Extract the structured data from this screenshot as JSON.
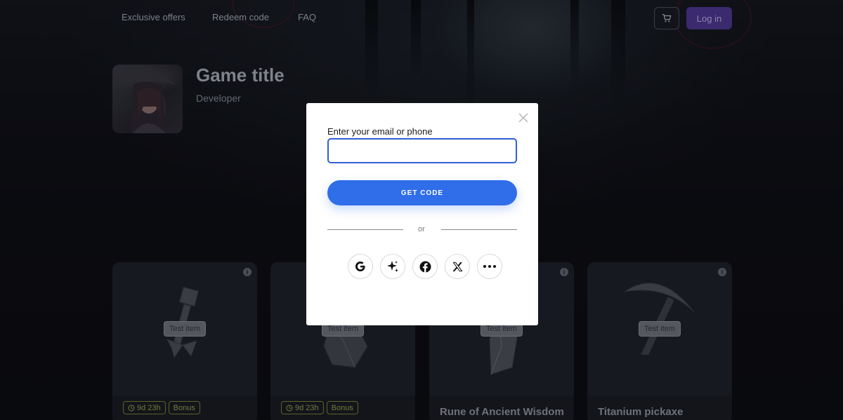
{
  "header": {
    "nav": [
      "Exclusive offers",
      "Redeem code",
      "FAQ"
    ],
    "login_label": "Log in"
  },
  "game": {
    "title": "Game title",
    "developer": "Developer"
  },
  "cards": [
    {
      "badge": "Test item",
      "timer": "9d 23h",
      "bonus": "Bonus",
      "name": ""
    },
    {
      "badge": "Test item",
      "timer": "9d 23h",
      "bonus": "Bonus",
      "name": ""
    },
    {
      "badge": "Test item",
      "timer": "",
      "bonus": "",
      "name": "Rune of Ancient Wisdom"
    },
    {
      "badge": "Test item",
      "timer": "",
      "bonus": "",
      "name": "Titanium pickaxe"
    }
  ],
  "modal": {
    "field_label": "Enter your email or phone",
    "field_value": "",
    "get_code_label": "GET CODE",
    "or_label": "or",
    "social_icons": [
      "google-icon",
      "sparkle-icon",
      "facebook-icon",
      "x-icon",
      "more-icon"
    ]
  },
  "colors": {
    "primary_button": "#2f6ee8",
    "login_button": "#3b2a6e",
    "modal_bg": "#ffffff",
    "page_bg": "#0e0f14"
  }
}
